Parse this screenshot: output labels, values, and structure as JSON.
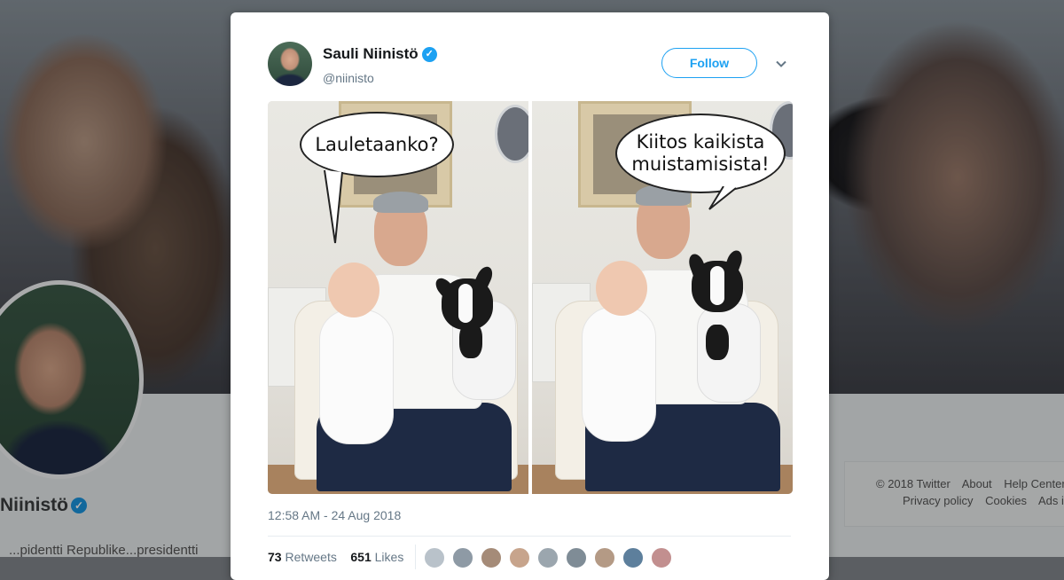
{
  "background_profile": {
    "name": "Niinistö",
    "bio_partial": "...pidentti Republike...presidentti",
    "footer": {
      "row1": [
        "© 2018 Twitter",
        "About",
        "Help Center"
      ],
      "row2": [
        "Privacy policy",
        "Cookies",
        "Ads in"
      ]
    }
  },
  "tweet": {
    "author_name": "Sauli Niinistö",
    "author_handle": "@niinisto",
    "verified": true,
    "follow_label": "Follow",
    "timestamp": "12:58 AM - 24 Aug 2018",
    "photo": {
      "left_bubble": "Lauletaanko?",
      "right_bubble_line1": "Kiitos kaikista",
      "right_bubble_line2": "muistamisista!"
    },
    "stats": {
      "retweets_count": "73",
      "retweets_label": "Retweets",
      "likes_count": "651",
      "likes_label": "Likes"
    },
    "liker_avatars": 9
  },
  "colors": {
    "accent": "#1da1f2",
    "text_primary": "#14171a",
    "text_secondary": "#657786",
    "verified": "#1da1f2"
  },
  "icons": {
    "verified": "verified-badge-icon",
    "caret": "chevron-down-icon"
  }
}
